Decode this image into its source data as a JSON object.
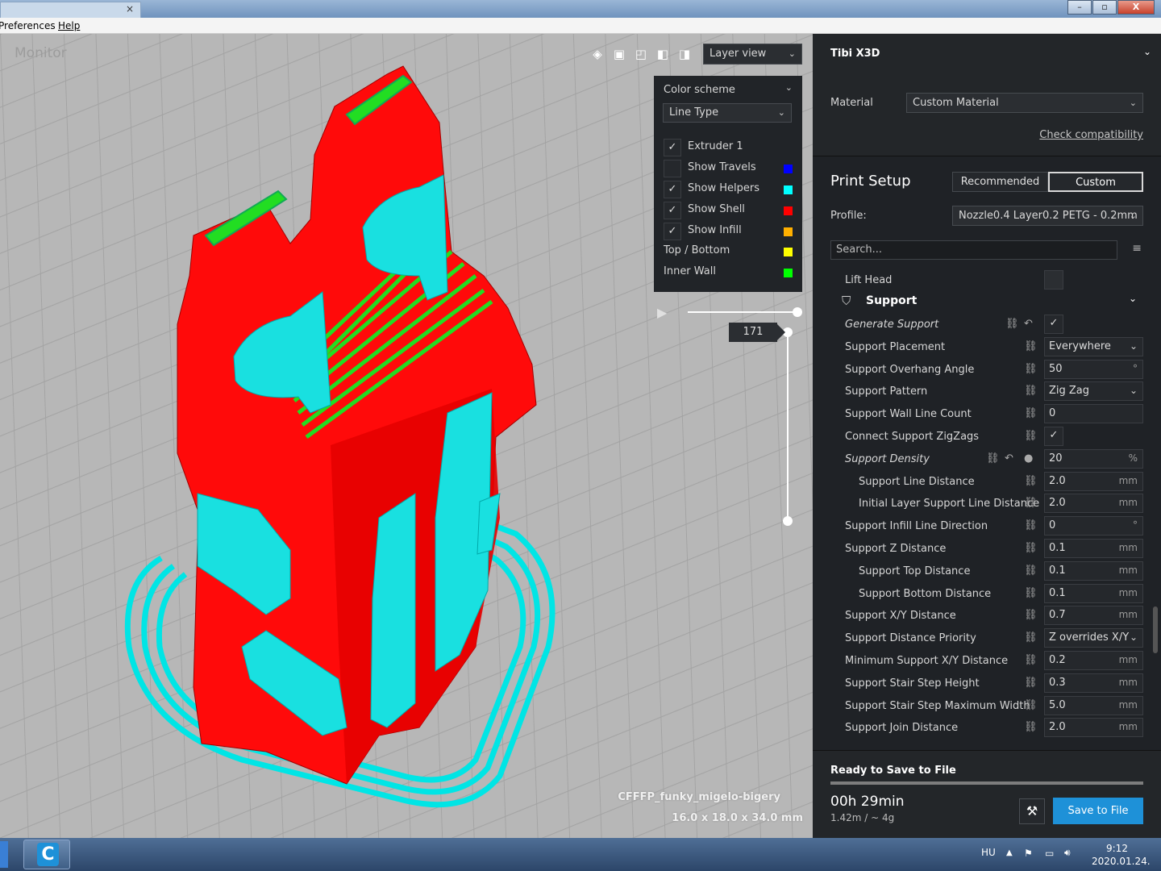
{
  "window": {
    "tab_title": "",
    "close_glyph": "×",
    "buttons": [
      "–",
      "▫",
      "X"
    ]
  },
  "menubar": {
    "items": [
      "Preferences",
      "Help"
    ]
  },
  "viewport": {
    "stage_label": "Monitor",
    "view_mode": "Layer view",
    "object_name": "CFFFP_funky_migelo-bigery",
    "object_dimensions": "16.0 x 18.0 x 34.0 mm",
    "current_layer": "171",
    "view_icons": [
      "3d-view-icon",
      "front-view-icon",
      "top-view-icon",
      "left-view-icon",
      "right-view-icon"
    ]
  },
  "layer_panel": {
    "color_scheme_label": "Color scheme",
    "color_scheme_value": "Line Type",
    "items": [
      {
        "label": "Extruder 1",
        "checked": true,
        "color": ""
      },
      {
        "label": "Show Travels",
        "checked": false,
        "color": "#0000ff"
      },
      {
        "label": "Show Helpers",
        "checked": true,
        "color": "#00ffff"
      },
      {
        "label": "Show Shell",
        "checked": true,
        "color": "#ff0000"
      },
      {
        "label": "Show Infill",
        "checked": true,
        "color": "#ffb000"
      }
    ],
    "legend": [
      {
        "label": "Top / Bottom",
        "color": "#ffff00"
      },
      {
        "label": "Inner Wall",
        "color": "#00ff00"
      }
    ]
  },
  "sidebar": {
    "printer": "Tibi X3D",
    "material_label": "Material",
    "material_value": "Custom Material",
    "check_compat": "Check compatibility",
    "print_setup": "Print Setup",
    "tab_recommended": "Recommended",
    "tab_custom": "Custom",
    "profile_label": "Profile:",
    "profile_value": "Nozzle0.4 Layer0.2 PETG - 0.2mm",
    "search_placeholder": "Search...",
    "lift_head": "Lift Head",
    "section": "Support",
    "settings": [
      {
        "name": "Generate Support",
        "value": "✓",
        "unit": "",
        "type": "check",
        "italic": true,
        "indent": 0
      },
      {
        "name": "Support Placement",
        "value": "Everywhere",
        "unit": "",
        "type": "select",
        "italic": false,
        "indent": 0
      },
      {
        "name": "Support Overhang Angle",
        "value": "50",
        "unit": "°",
        "type": "text",
        "italic": false,
        "indent": 0
      },
      {
        "name": "Support Pattern",
        "value": "Zig Zag",
        "unit": "",
        "type": "select",
        "italic": false,
        "indent": 0
      },
      {
        "name": "Support Wall Line Count",
        "value": "0",
        "unit": "",
        "type": "text",
        "italic": false,
        "indent": 0
      },
      {
        "name": "Connect Support ZigZags",
        "value": "✓",
        "unit": "",
        "type": "check",
        "italic": false,
        "indent": 0
      },
      {
        "name": "Support Density",
        "value": "20",
        "unit": "%",
        "type": "text",
        "italic": true,
        "indent": 0
      },
      {
        "name": "Support Line Distance",
        "value": "2.0",
        "unit": "mm",
        "type": "text",
        "italic": false,
        "indent": 1
      },
      {
        "name": "Initial Layer Support Line Distance",
        "value": "2.0",
        "unit": "mm",
        "type": "text",
        "italic": false,
        "indent": 1
      },
      {
        "name": "Support Infill Line Direction",
        "value": "0",
        "unit": "°",
        "type": "text",
        "italic": false,
        "indent": 0
      },
      {
        "name": "Support Z Distance",
        "value": "0.1",
        "unit": "mm",
        "type": "text",
        "italic": false,
        "indent": 0
      },
      {
        "name": "Support Top Distance",
        "value": "0.1",
        "unit": "mm",
        "type": "text",
        "italic": false,
        "indent": 1
      },
      {
        "name": "Support Bottom Distance",
        "value": "0.1",
        "unit": "mm",
        "type": "text",
        "italic": false,
        "indent": 1
      },
      {
        "name": "Support X/Y Distance",
        "value": "0.7",
        "unit": "mm",
        "type": "text",
        "italic": false,
        "indent": 0
      },
      {
        "name": "Support Distance Priority",
        "value": "Z overrides X/Y",
        "unit": "",
        "type": "select",
        "italic": false,
        "indent": 0
      },
      {
        "name": "Minimum Support X/Y Distance",
        "value": "0.2",
        "unit": "mm",
        "type": "text",
        "italic": false,
        "indent": 0
      },
      {
        "name": "Support Stair Step Height",
        "value": "0.3",
        "unit": "mm",
        "type": "text",
        "italic": false,
        "indent": 0
      },
      {
        "name": "Support Stair Step Maximum Width",
        "value": "5.0",
        "unit": "mm",
        "type": "text",
        "italic": false,
        "indent": 0
      },
      {
        "name": "Support Join Distance",
        "value": "2.0",
        "unit": "mm",
        "type": "text",
        "italic": false,
        "indent": 0
      }
    ],
    "footer": {
      "status": "Ready to Save to File",
      "time": "00h 29min",
      "usage": "1.42m / ~ 4g",
      "save_button": "Save to File"
    }
  },
  "taskbar": {
    "lang": "HU",
    "time": "9:12",
    "date": "2020.01.24.",
    "app_letter": "C"
  }
}
